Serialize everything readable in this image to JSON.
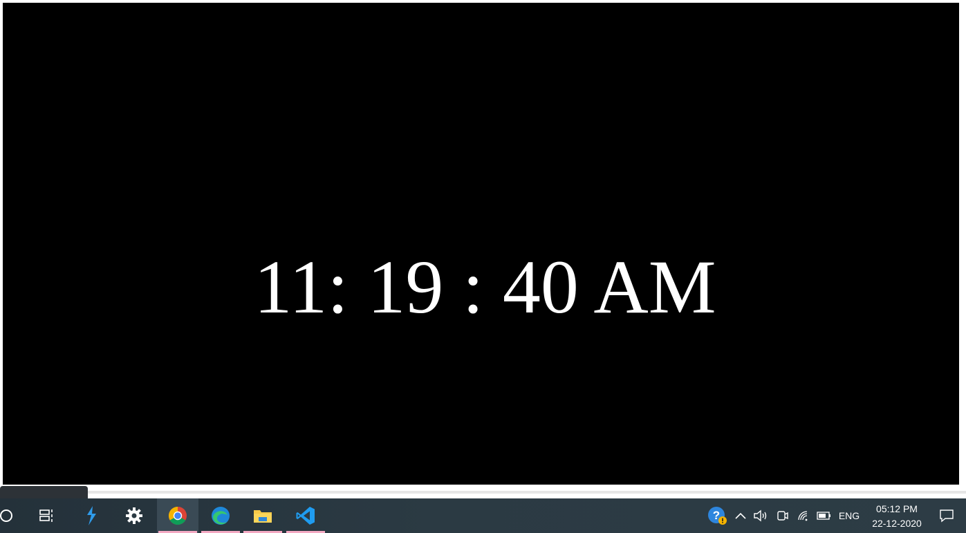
{
  "browser": {
    "clock_display": "11: 19 : 40 AM"
  },
  "taskbar": {
    "apps": [
      {
        "name": "Search",
        "icon": "search-circle-icon"
      },
      {
        "name": "Task View",
        "icon": "task-view-icon"
      },
      {
        "name": "App",
        "icon": "lightning-app-icon"
      },
      {
        "name": "Settings",
        "icon": "gear-icon"
      },
      {
        "name": "Google Chrome",
        "icon": "chrome-icon",
        "active": true
      },
      {
        "name": "Microsoft Edge",
        "icon": "edge-icon"
      },
      {
        "name": "File Explorer",
        "icon": "folder-icon"
      },
      {
        "name": "Visual Studio Code",
        "icon": "vscode-icon"
      }
    ],
    "tray": {
      "language": "ENG",
      "time": "05:12 PM",
      "date": "22-12-2020"
    }
  },
  "colors": {
    "canvas": "#000000",
    "clock_text": "#ffffff",
    "taskbar": "#2b3a43",
    "active_indicator": "#f4a9c3"
  }
}
